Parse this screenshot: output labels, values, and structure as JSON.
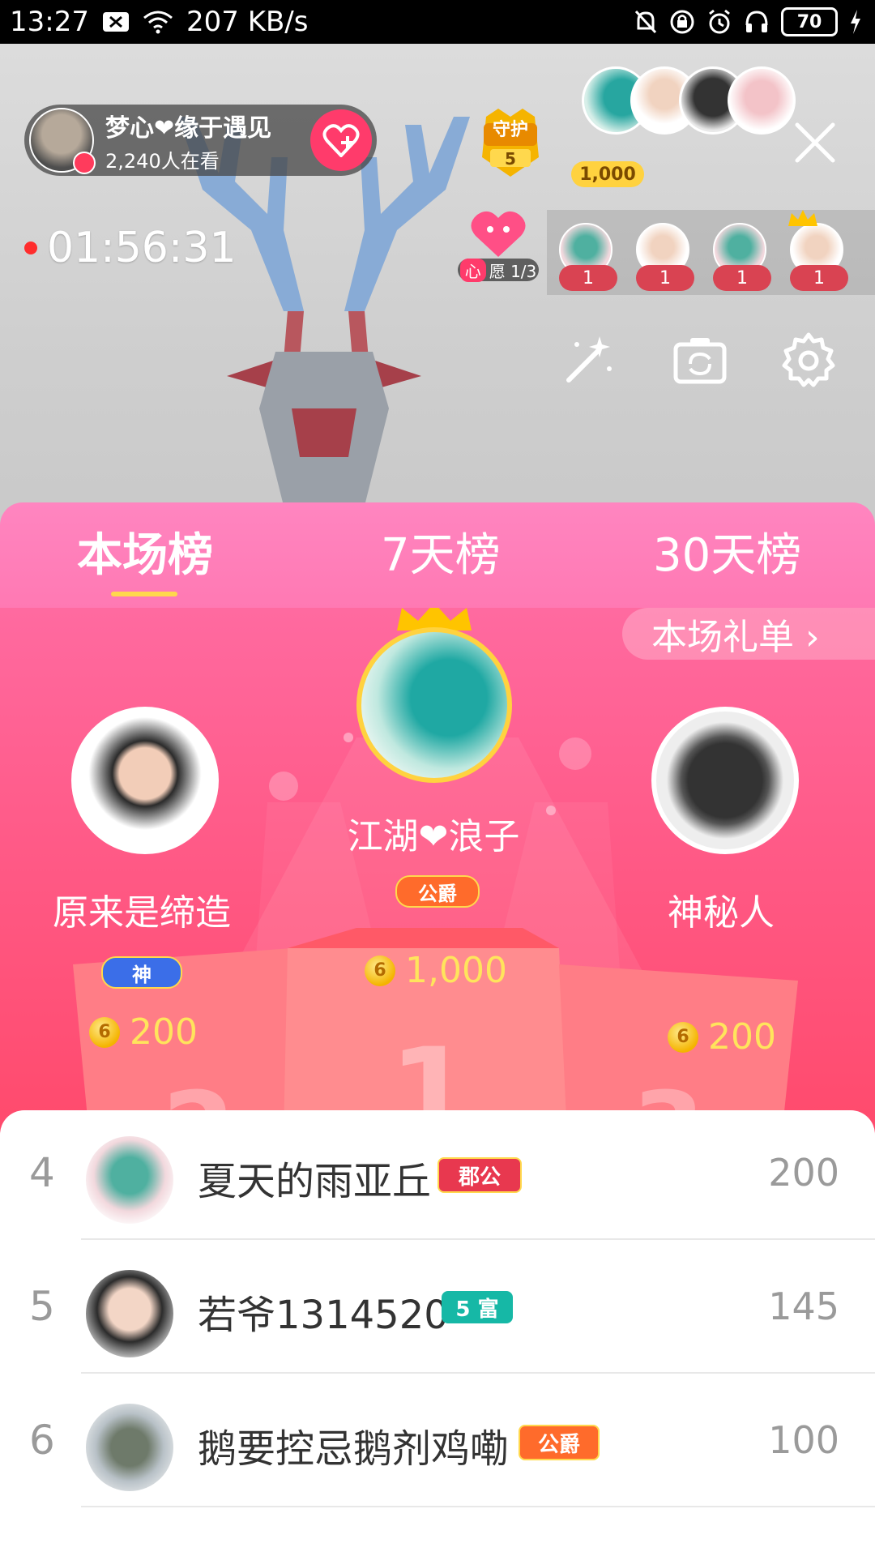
{
  "status_bar": {
    "time": "13:27",
    "network_speed": "207 KB/s",
    "battery": "70"
  },
  "live": {
    "host_name": "梦心❤缘于遇见",
    "viewers": "2,240人在看",
    "guard_label": "守护",
    "guard_count": "5",
    "top_fan_coins": "1,000",
    "timer": "01:56:31",
    "wish_prefix": "心",
    "wish_text": "愿 1/3",
    "gift_counts": [
      "1",
      "1",
      "1",
      "1"
    ]
  },
  "tabs": {
    "current": "本场榜",
    "week": "7天榜",
    "month": "30天榜"
  },
  "gift_list_link": "本场礼单 ›",
  "podium": {
    "first": {
      "name": "江湖❤浪子",
      "badge": "公爵",
      "score": "1,000"
    },
    "second": {
      "name": "原来是缔造",
      "badge": "神",
      "score": "200"
    },
    "third": {
      "name": "神秘人",
      "score": "200"
    }
  },
  "coin_symbol": "6",
  "list": [
    {
      "rank": "4",
      "name": "夏天的雨亚丘",
      "badge": "郡公",
      "score": "200"
    },
    {
      "rank": "5",
      "name": "若爷1314520",
      "badge": "5 富",
      "score": "145"
    },
    {
      "rank": "6",
      "name": "鹅要控忌鹅剂鸡嘞",
      "badge": "公爵",
      "score": "100"
    }
  ],
  "colors": {
    "accent_pink": "#ff5a87",
    "tab_pink": "#ff85c0",
    "gold": "#ffe45c",
    "badge_teal": "#16b8a6",
    "badge_orange": "#ff6b2b",
    "badge_red": "#e8384f"
  }
}
